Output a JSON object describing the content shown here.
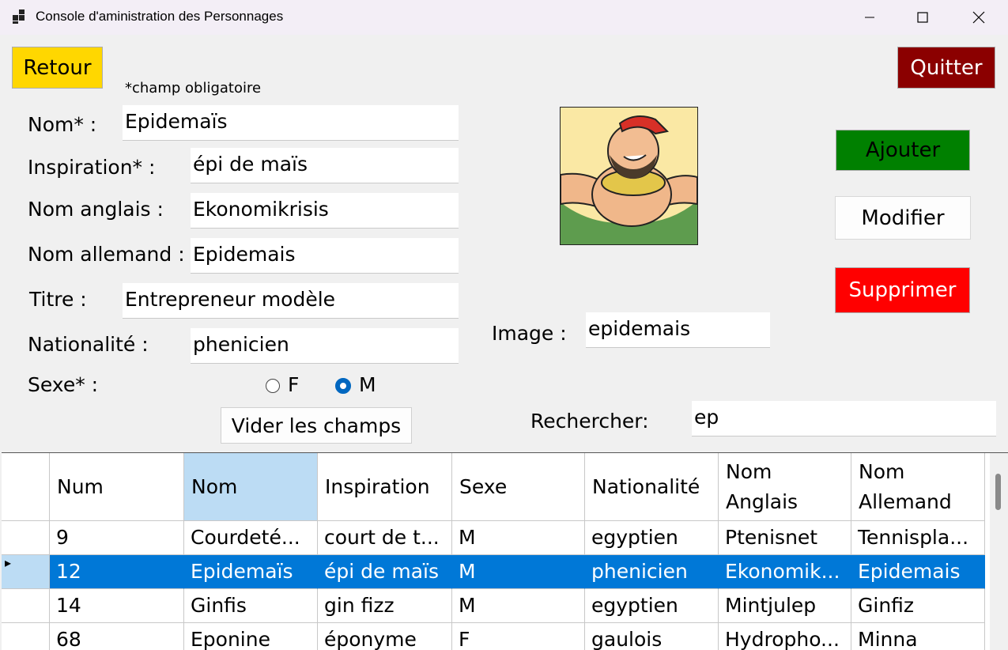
{
  "window": {
    "title": "Console d'aministration des Personnages"
  },
  "buttons": {
    "back": "Retour",
    "quit": "Quitter",
    "add": "Ajouter",
    "edit": "Modifier",
    "delete": "Supprimer",
    "clear": "Vider les champs"
  },
  "colors": {
    "back": "#ffd700",
    "quit": "#8b0000",
    "add": "#008000",
    "delete": "#ff0000",
    "selection": "#0078d7",
    "header_selected": "#bcdcf4"
  },
  "form": {
    "required_note": "*champ obligatoire",
    "nom_label": "Nom* :",
    "nom_value": "Epidemaïs",
    "inspiration_label": "Inspiration* :",
    "inspiration_value": "épi de maïs",
    "nom_anglais_label": "Nom anglais :",
    "nom_anglais_value": "Ekonomikrisis",
    "nom_allemand_label": "Nom allemand :",
    "nom_allemand_value": "Epidemais",
    "titre_label": "Titre :",
    "titre_value": "Entrepreneur modèle",
    "nationalite_label": "Nationalité :",
    "nationalite_value": "phenicien",
    "sexe_label": "Sexe* :",
    "sexe_f": "F",
    "sexe_m": "M",
    "sexe_selected": "M",
    "image_label": "Image :",
    "image_value": "epidemais",
    "search_label": "Rechercher:",
    "search_value": "ep"
  },
  "grid": {
    "headers": [
      "Num",
      "Nom",
      "Inspiration",
      "Sexe",
      "Nationalité",
      "Nom Anglais",
      "Nom Allemand"
    ],
    "header_lines": [
      [
        "Num"
      ],
      [
        "Nom"
      ],
      [
        "Inspiration"
      ],
      [
        "Sexe"
      ],
      [
        "Nationalité"
      ],
      [
        "Nom",
        "Anglais"
      ],
      [
        "Nom",
        "Allemand"
      ]
    ],
    "selected_row": 1,
    "rows": [
      [
        "9",
        "Courdeté...",
        "court de t...",
        "M",
        "egyptien",
        "Ptenisnet",
        "Tennispla..."
      ],
      [
        "12",
        "Epidemaïs",
        "épi de maïs",
        "M",
        "phenicien",
        "Ekonomik...",
        "Epidemais"
      ],
      [
        "14",
        "Ginfis",
        "gin fizz",
        "M",
        "egyptien",
        "Mintjulep",
        "Ginfiz"
      ],
      [
        "68",
        "Eponine",
        "éponyme",
        "F",
        "gaulois",
        "Hydropho...",
        "Minna"
      ]
    ]
  }
}
